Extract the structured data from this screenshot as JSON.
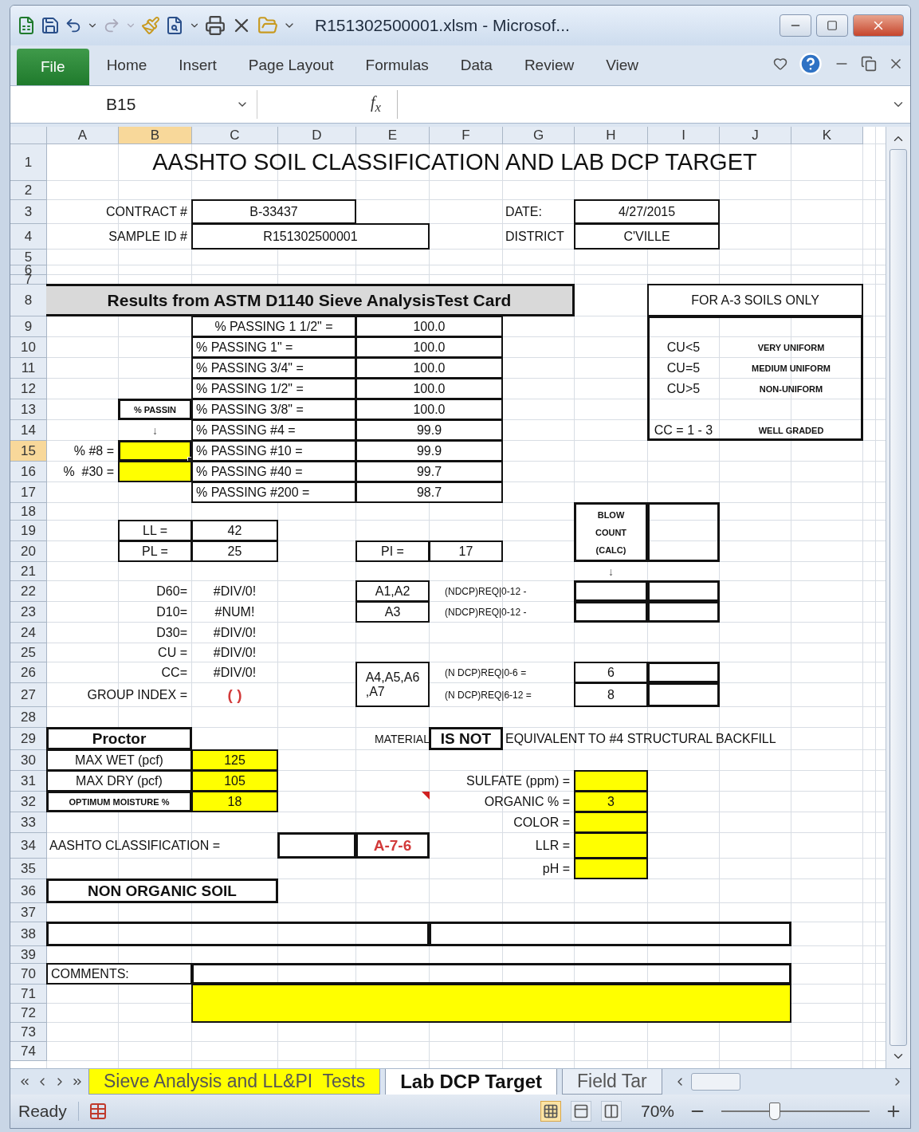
{
  "window": {
    "title": "R151302500001.xlsm - Microsof..."
  },
  "ribbon_tabs": [
    {
      "label": "File",
      "kind": "file"
    },
    {
      "label": "Home",
      "kind": "tab"
    },
    {
      "label": "Insert",
      "kind": "tab"
    },
    {
      "label": "Page Layout",
      "kind": "tab"
    },
    {
      "label": "Formulas",
      "kind": "tab"
    },
    {
      "label": "Data",
      "kind": "tab"
    },
    {
      "label": "Review",
      "kind": "tab"
    },
    {
      "label": "View",
      "kind": "tab"
    }
  ],
  "formula_bar": {
    "name_box": "B15",
    "fx": "f$_{x}$"
  },
  "sheet": {
    "columns": [
      {
        "label": "A",
        "selected": false
      },
      {
        "label": "B",
        "selected": true
      },
      {
        "label": "C",
        "selected": false
      },
      {
        "label": "D",
        "selected": false
      },
      {
        "label": "E",
        "selected": false
      },
      {
        "label": "F",
        "selected": false
      },
      {
        "label": "G",
        "selected": false
      },
      {
        "label": "H",
        "selected": false
      },
      {
        "label": "I",
        "selected": false
      },
      {
        "label": "J",
        "selected": false
      },
      {
        "label": "K",
        "selected": false
      }
    ],
    "rows": [
      {
        "label": "1",
        "selected": false,
        "cells": [
          {
            "kind": "title",
            "text": "AASHTO SOIL CLASSIFICATION AND LAB DCP TARGET"
          }
        ]
      },
      {
        "label": "2",
        "selected": false
      },
      {
        "label": "3",
        "selected": false,
        "cells": [
          {
            "kind": "label_right",
            "text": "CONTRACT #"
          },
          {
            "kind": "boxed",
            "text": "B-33437"
          },
          {
            "kind": "label",
            "text": "DATE:"
          },
          {
            "kind": "boxed",
            "text": "4/27/2015"
          }
        ]
      },
      {
        "label": "4",
        "selected": false,
        "cells": [
          {
            "kind": "label_right",
            "text": "SAMPLE ID #"
          },
          {
            "kind": "boxed",
            "text": "R151302500001"
          },
          {
            "kind": "label",
            "text": "DISTRICT"
          },
          {
            "kind": "boxed",
            "text": "C'VILLE"
          }
        ]
      },
      {
        "label": "5",
        "selected": false
      },
      {
        "label": "6",
        "selected": false
      },
      {
        "label": "7",
        "selected": false
      },
      {
        "label": "8",
        "selected": false,
        "cells": [
          {
            "kind": "heading",
            "text": "Results from ASTM D1140 Sieve AnalysisTest Card"
          },
          {
            "kind": "boxed",
            "text": "FOR A-3 SOILS ONLY"
          }
        ]
      },
      {
        "label": "9",
        "selected": false,
        "cells": [
          {
            "kind": "boxed",
            "text": "% PASSING 1 1/2\" ="
          },
          {
            "kind": "boxed",
            "text": "100.0"
          },
          {
            "kind": "frame"
          }
        ]
      },
      {
        "label": "10",
        "selected": false,
        "cells": [
          {
            "kind": "boxed_left",
            "text": "% PASSING 1\" ="
          },
          {
            "kind": "boxed",
            "text": "100.0"
          },
          {
            "kind": "center",
            "text": "CU<5"
          },
          {
            "kind": "tiny",
            "text": "VERY UNIFORM"
          }
        ]
      },
      {
        "label": "11",
        "selected": false,
        "cells": [
          {
            "kind": "boxed_left",
            "text": "% PASSING 3/4\" ="
          },
          {
            "kind": "boxed",
            "text": "100.0"
          },
          {
            "kind": "center",
            "text": "CU=5"
          },
          {
            "kind": "tiny",
            "text": "MEDIUM UNIFORM"
          }
        ]
      },
      {
        "label": "12",
        "selected": false,
        "cells": [
          {
            "kind": "boxed_left",
            "text": "% PASSING 1/2\" ="
          },
          {
            "kind": "boxed",
            "text": "100.0"
          },
          {
            "kind": "center",
            "text": "CU>5"
          },
          {
            "kind": "tiny",
            "text": "NON-UNIFORM"
          }
        ]
      },
      {
        "label": "13",
        "selected": false,
        "cells": [
          {
            "kind": "tiny_boxed",
            "text": "% PASSIN"
          },
          {
            "kind": "boxed_left",
            "text": "% PASSING 3/8\" ="
          },
          {
            "kind": "boxed",
            "text": "100.0"
          }
        ]
      },
      {
        "label": "14",
        "selected": false,
        "cells": [
          {
            "kind": "arrow",
            "text": "↓"
          },
          {
            "kind": "boxed_left",
            "text": "% PASSING #4 ="
          },
          {
            "kind": "boxed",
            "text": "99.9"
          },
          {
            "kind": "center",
            "text": "CC = 1 - 3"
          },
          {
            "kind": "tiny",
            "text": "WELL GRADED"
          }
        ]
      },
      {
        "label": "15",
        "selected": true,
        "cells": [
          {
            "kind": "label_right",
            "text": "% #8 ="
          },
          {
            "kind": "input"
          },
          {
            "kind": "boxed_left",
            "text": "% PASSING #10 ="
          },
          {
            "kind": "boxed",
            "text": "99.9"
          }
        ]
      },
      {
        "label": "16",
        "selected": false,
        "cells": [
          {
            "kind": "label_right",
            "text": "%  #30 ="
          },
          {
            "kind": "input"
          },
          {
            "kind": "boxed_left",
            "text": "% PASSING #40 ="
          },
          {
            "kind": "boxed",
            "text": "99.7"
          }
        ]
      },
      {
        "label": "17",
        "selected": false,
        "cells": [
          {
            "kind": "boxed_left",
            "text": "% PASSING #200 ="
          },
          {
            "kind": "boxed",
            "text": "98.7"
          }
        ]
      },
      {
        "label": "18",
        "selected": false
      },
      {
        "label": "19",
        "selected": false,
        "cells": [
          {
            "kind": "boxed",
            "text": "LL ="
          },
          {
            "kind": "boxed",
            "text": "42"
          },
          {
            "kind": "tiny_boxed",
            "text": "BLOW\nCOUNT\n(CALC)"
          },
          {
            "kind": "frame"
          }
        ]
      },
      {
        "label": "20",
        "selected": false,
        "cells": [
          {
            "kind": "boxed",
            "text": "PL ="
          },
          {
            "kind": "boxed",
            "text": "25"
          },
          {
            "kind": "boxed",
            "text": "PI ="
          },
          {
            "kind": "boxed",
            "text": "17"
          }
        ]
      },
      {
        "label": "21",
        "selected": false,
        "cells": [
          {
            "kind": "arrow",
            "text": "↓"
          }
        ]
      },
      {
        "label": "22",
        "selected": false,
        "cells": [
          {
            "kind": "label_right",
            "text": "D60="
          },
          {
            "kind": "center",
            "text": "#DIV/0!"
          },
          {
            "kind": "boxed",
            "text": "A1,A2"
          },
          {
            "kind": "note",
            "text": "(NDCP)REQ|0-12 -"
          },
          {
            "kind": "frame"
          },
          {
            "kind": "frame"
          }
        ]
      },
      {
        "label": "23",
        "selected": false,
        "cells": [
          {
            "kind": "label_right",
            "text": "D10="
          },
          {
            "kind": "center",
            "text": "#NUM!"
          },
          {
            "kind": "boxed",
            "text": "A3"
          },
          {
            "kind": "note",
            "text": "(NDCP)REQ|0-12 -"
          },
          {
            "kind": "frame"
          },
          {
            "kind": "frame"
          }
        ]
      },
      {
        "label": "24",
        "selected": false,
        "cells": [
          {
            "kind": "label_right",
            "text": "D30="
          },
          {
            "kind": "center",
            "text": "#DIV/0!"
          }
        ]
      },
      {
        "label": "25",
        "selected": false,
        "cells": [
          {
            "kind": "label_right",
            "text": "CU ="
          },
          {
            "kind": "center",
            "text": "#DIV/0!"
          }
        ]
      },
      {
        "label": "26",
        "selected": false,
        "cells": [
          {
            "kind": "label_right",
            "text": "CC="
          },
          {
            "kind": "center",
            "text": "#DIV/0!"
          },
          {
            "kind": "boxed",
            "text": "A4,A5,A6\n,A7"
          },
          {
            "kind": "note",
            "text": "(N DCP)REQ|0-6 ="
          },
          {
            "kind": "boxed",
            "text": "6"
          },
          {
            "kind": "frame"
          }
        ]
      },
      {
        "label": "27",
        "selected": false,
        "cells": [
          {
            "kind": "label_right",
            "text": "GROUP INDEX ="
          },
          {
            "kind": "red",
            "text": "( )"
          },
          {
            "kind": "note",
            "text": "(N DCP)REQ|6-12 ="
          },
          {
            "kind": "boxed",
            "text": "8"
          },
          {
            "kind": "frame"
          }
        ]
      },
      {
        "label": "28",
        "selected": false
      },
      {
        "label": "29",
        "selected": false,
        "cells": [
          {
            "kind": "bold_boxed",
            "text": "Proctor"
          },
          {
            "kind": "small_right",
            "text": "MATERIAL"
          },
          {
            "kind": "bold_boxed",
            "text": "IS NOT"
          },
          {
            "kind": "label",
            "text": "EQUIVALENT TO #4 STRUCTURAL BACKFILL"
          }
        ]
      },
      {
        "label": "30",
        "selected": false,
        "cells": [
          {
            "kind": "boxed",
            "text": "MAX WET (pcf)"
          },
          {
            "kind": "input",
            "text": "125"
          }
        ]
      },
      {
        "label": "31",
        "selected": false,
        "cells": [
          {
            "kind": "boxed",
            "text": "MAX DRY (pcf)"
          },
          {
            "kind": "input",
            "text": "105"
          },
          {
            "kind": "label_right",
            "text": "SULFATE (ppm) ="
          },
          {
            "kind": "input"
          }
        ]
      },
      {
        "label": "32",
        "selected": false,
        "cells": [
          {
            "kind": "tiny_boxed",
            "text": "OPTIMUM MOISTURE %"
          },
          {
            "kind": "input",
            "text": "18"
          },
          {
            "kind": "comment"
          },
          {
            "kind": "label_right",
            "text": "ORGANIC % ="
          },
          {
            "kind": "input",
            "text": "3"
          }
        ]
      },
      {
        "label": "33",
        "selected": false,
        "cells": [
          {
            "kind": "label_right",
            "text": "COLOR ="
          },
          {
            "kind": "input"
          }
        ]
      },
      {
        "label": "34",
        "selected": false,
        "cells": [
          {
            "kind": "label",
            "text": "AASHTO CLASSIFICATION ="
          },
          {
            "kind": "frame"
          },
          {
            "kind": "red_boxed",
            "text": "A-7-6"
          },
          {
            "kind": "label_right",
            "text": "LLR ="
          },
          {
            "kind": "input"
          }
        ]
      },
      {
        "label": "35",
        "selected": false,
        "cells": [
          {
            "kind": "label_right",
            "text": "pH ="
          },
          {
            "kind": "input"
          }
        ]
      },
      {
        "label": "36",
        "selected": false,
        "cells": [
          {
            "kind": "bold_boxed",
            "text": "NON ORGANIC SOIL"
          }
        ]
      },
      {
        "label": "37",
        "selected": false
      },
      {
        "label": "38",
        "selected": false,
        "cells": [
          {
            "kind": "frame"
          },
          {
            "kind": "frame"
          }
        ]
      },
      {
        "label": "39",
        "selected": false
      },
      {
        "label": "70",
        "selected": false,
        "cells": [
          {
            "kind": "boxed_left",
            "text": "COMMENTS:"
          },
          {
            "kind": "frame"
          }
        ]
      },
      {
        "label": "71",
        "selected": false,
        "cells": [
          {
            "kind": "input"
          }
        ]
      },
      {
        "label": "72",
        "selected": false
      },
      {
        "label": "73",
        "selected": false
      },
      {
        "label": "74",
        "selected": false
      }
    ]
  },
  "sheet_tabs": [
    {
      "label": "Sieve Analysis and LL&PI  Tests",
      "selected": false,
      "color": "#ffff00"
    },
    {
      "label": "Lab DCP Target",
      "selected": true
    },
    {
      "label": "Field Tar",
      "selected": false
    }
  ],
  "status_bar": {
    "status": "Ready",
    "zoom": "70%",
    "zoom_slider": {
      "level": 0.36
    }
  }
}
